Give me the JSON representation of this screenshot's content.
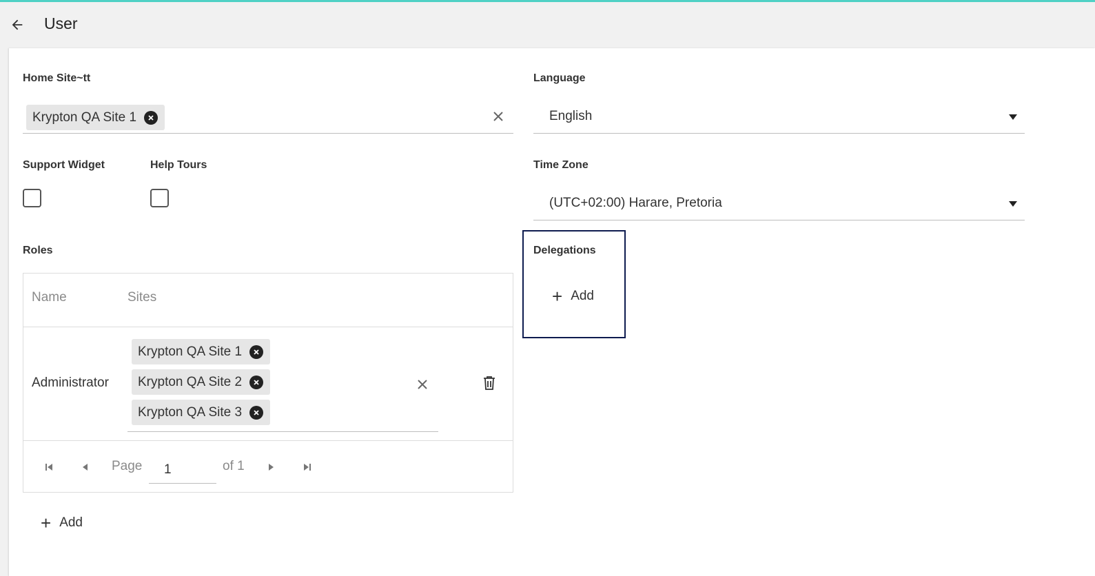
{
  "header": {
    "title": "User"
  },
  "home_site": {
    "label": "Home Site~tt",
    "chips": [
      "Krypton QA Site 1"
    ]
  },
  "language": {
    "label": "Language",
    "value": "English"
  },
  "support_widget": {
    "label": "Support Widget",
    "checked": false
  },
  "help_tours": {
    "label": "Help Tours",
    "checked": false
  },
  "time_zone": {
    "label": "Time Zone",
    "value": "(UTC+02:00) Harare, Pretoria"
  },
  "roles": {
    "label": "Roles",
    "columns": [
      "Name",
      "Sites"
    ],
    "rows": [
      {
        "name": "Administrator",
        "sites": [
          "Krypton QA Site 1",
          "Krypton QA Site 2",
          "Krypton QA Site 3"
        ]
      }
    ],
    "pager": {
      "page_label": "Page",
      "page": "1",
      "of_label": "of 1"
    },
    "add_label": "Add"
  },
  "delegations": {
    "label": "Delegations",
    "add_label": "Add"
  },
  "colors": {
    "accent": "#4fd1c5",
    "highlight_border": "#0d1b4f"
  },
  "icons": {
    "back": "arrow-left-icon",
    "chip_remove": "circle-x-icon",
    "clear": "close-icon",
    "dropdown": "caret-down-icon",
    "delete": "trash-icon",
    "first": "first-page-icon",
    "prev": "prev-page-icon",
    "next": "next-page-icon",
    "last": "last-page-icon",
    "add": "plus-icon"
  }
}
